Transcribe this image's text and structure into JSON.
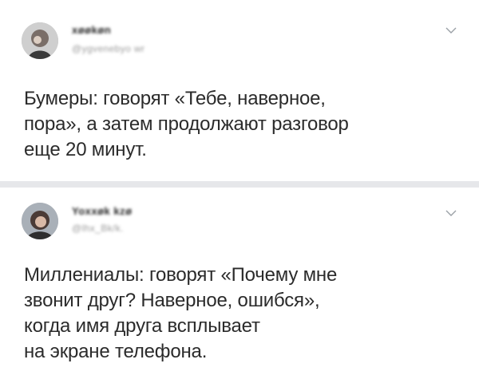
{
  "tweets": [
    {
      "author_name": "xøøkøn",
      "author_handle": "@ygvenebyo wr",
      "text_lines": [
        "Бумеры: говорят «Тебе, наверное,",
        "пора», а затем продолжают разговор",
        "еще 20 минут."
      ]
    },
    {
      "author_name": "Yoxxøk kzø",
      "author_handle": "@lhx_Bk/k.",
      "text_lines": [
        "Миллениалы: говорят «Почему мне",
        "звонит друг? Наверное, ошибся»,",
        "когда имя друга всплывает",
        "на экране телефона."
      ]
    }
  ],
  "icons": {
    "menu": "chevron-down-icon"
  },
  "colors": {
    "background": "#e6e7ea",
    "card": "#ffffff",
    "text": "#2b2b2b",
    "handle": "#9a9a9a"
  }
}
